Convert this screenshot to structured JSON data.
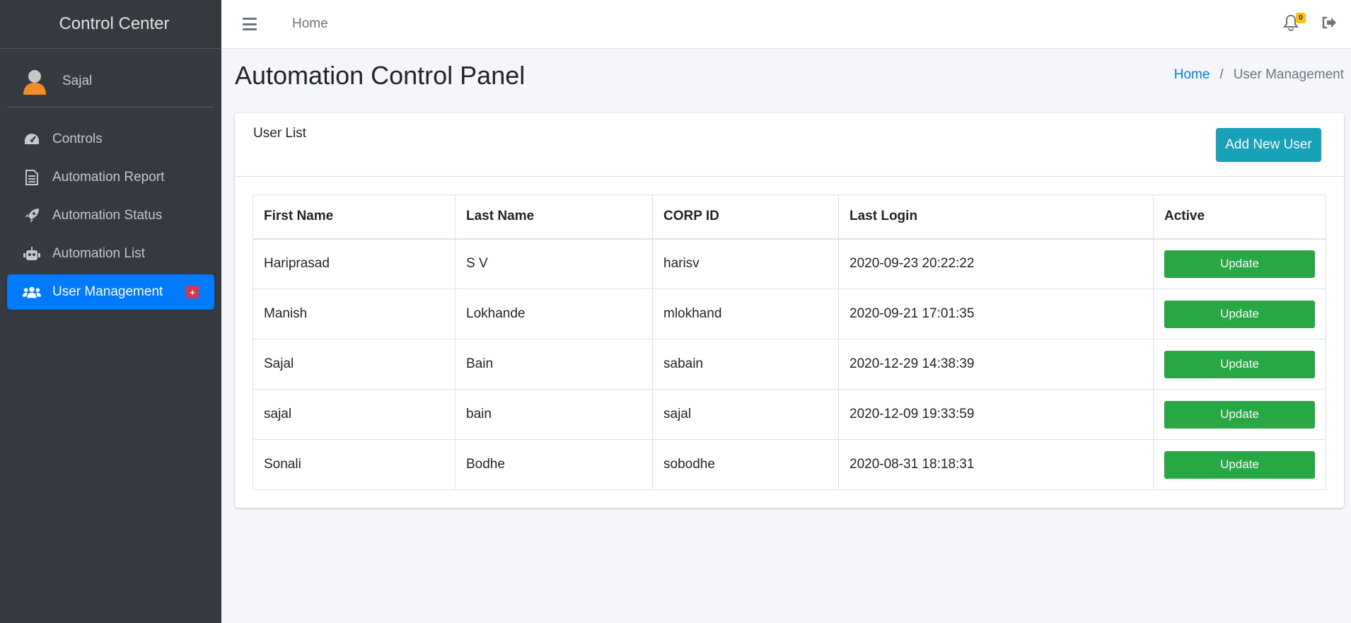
{
  "app": {
    "brand": "Control Center"
  },
  "sidebar": {
    "user_name": "Sajal",
    "items": [
      {
        "label": "Controls",
        "icon": "tachometer-icon"
      },
      {
        "label": "Automation Report",
        "icon": "file-icon"
      },
      {
        "label": "Automation Status",
        "icon": "rocket-icon"
      },
      {
        "label": "Automation List",
        "icon": "robot-icon"
      },
      {
        "label": "User Management",
        "icon": "users-icon",
        "active": true,
        "badge": "+"
      }
    ]
  },
  "navbar": {
    "home_label": "Home",
    "notification_count": "0"
  },
  "header": {
    "title": "Automation Control Panel",
    "breadcrumb": {
      "home": "Home",
      "separator": "/",
      "current": "User Management"
    }
  },
  "card": {
    "title": "User List",
    "add_button_label": "Add New User",
    "columns": [
      "First Name",
      "Last Name",
      "CORP ID",
      "Last Login",
      "Active"
    ],
    "rows": [
      {
        "first": "Hariprasad",
        "last": "S V",
        "corp_id": "harisv",
        "last_login": "2020-09-23 20:22:22",
        "action": "Update"
      },
      {
        "first": "Manish",
        "last": "Lokhande",
        "corp_id": "mlokhand",
        "last_login": "2020-09-21 17:01:35",
        "action": "Update"
      },
      {
        "first": "Sajal",
        "last": "Bain",
        "corp_id": "sabain",
        "last_login": "2020-12-29 14:38:39",
        "action": "Update"
      },
      {
        "first": "sajal",
        "last": "bain",
        "corp_id": "sajal",
        "last_login": "2020-12-09 19:33:59",
        "action": "Update"
      },
      {
        "first": "Sonali",
        "last": "Bodhe",
        "corp_id": "sobodhe",
        "last_login": "2020-08-31 18:18:31",
        "action": "Update"
      }
    ]
  },
  "colors": {
    "sidebar_bg": "#343a40",
    "primary": "#007bff",
    "info": "#17a2b8",
    "success": "#28a745",
    "danger": "#dc3545",
    "warning": "#ffc107"
  }
}
